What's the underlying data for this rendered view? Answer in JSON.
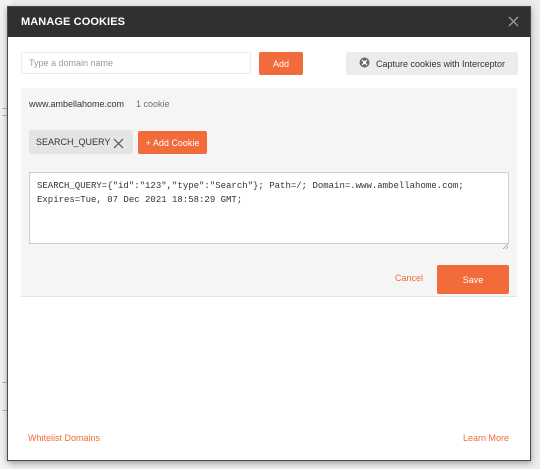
{
  "modal": {
    "title": "MANAGE COOKIES"
  },
  "toolbar": {
    "domain_placeholder": "Type a domain name",
    "domain_value": "",
    "add_label": "Add",
    "interceptor_label": "Capture cookies with Interceptor",
    "interceptor_icon": "satellite-icon"
  },
  "panel": {
    "domain": "www.ambellahome.com",
    "cookie_count": "1 cookie",
    "cookies": [
      {
        "name": "SEARCH_QUERY"
      }
    ],
    "add_cookie_label": "+ Add Cookie",
    "cookie_value": "SEARCH_QUERY={\"id\":\"123\",\"type\":\"Search\"}; Path=/; Domain=.www.ambellahome.com;\nExpires=Tue, 07 Dec 2021 18:58:29 GMT;",
    "cancel_label": "Cancel",
    "save_label": "Save"
  },
  "footer": {
    "whitelist_label": "Whitelist Domains",
    "learn_more_label": "Learn More"
  },
  "colors": {
    "accent": "#f26b3a",
    "header": "#303030",
    "panel": "#f5f5f5"
  }
}
